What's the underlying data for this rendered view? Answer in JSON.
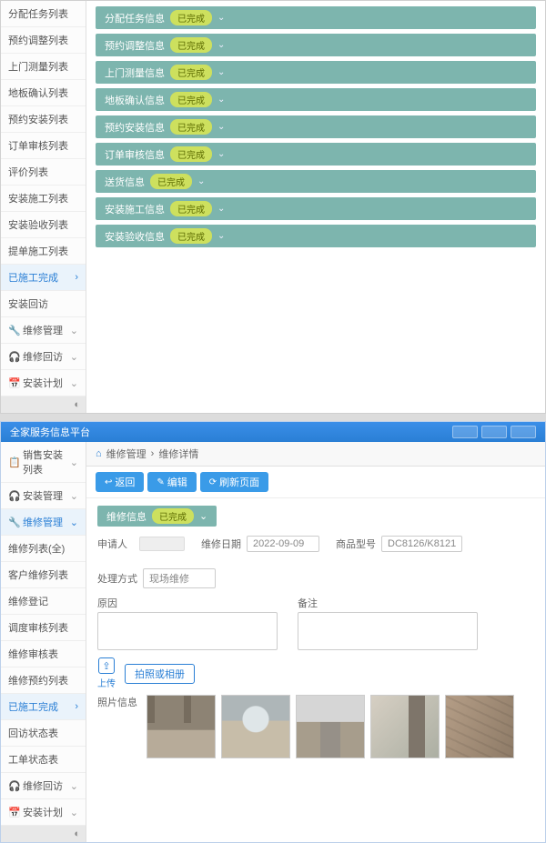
{
  "top": {
    "sidebar": {
      "items": [
        {
          "label": "分配任务列表"
        },
        {
          "label": "预约调整列表"
        },
        {
          "label": "上门测量列表"
        },
        {
          "label": "地板确认列表"
        },
        {
          "label": "预约安装列表"
        },
        {
          "label": "订单审核列表"
        },
        {
          "label": "评价列表"
        },
        {
          "label": "安装施工列表"
        },
        {
          "label": "安装验收列表"
        },
        {
          "label": "提单施工列表"
        },
        {
          "label": "已施工完成",
          "selected": true
        },
        {
          "label": "安装回访"
        }
      ],
      "bottom": [
        {
          "icon": "🔧",
          "label": "维修管理"
        },
        {
          "icon": "🎧",
          "label": "维修回访"
        },
        {
          "icon": "📅",
          "label": "安装计划"
        }
      ]
    },
    "accordions": [
      {
        "title": "分配任务信息",
        "badge": "已完成"
      },
      {
        "title": "预约调整信息",
        "badge": "已完成"
      },
      {
        "title": "上门测量信息",
        "badge": "已完成"
      },
      {
        "title": "地板确认信息",
        "badge": "已完成"
      },
      {
        "title": "预约安装信息",
        "badge": "已完成"
      },
      {
        "title": "订单审核信息",
        "badge": "已完成"
      },
      {
        "title": "送货信息",
        "badge": "已完成"
      },
      {
        "title": "安装施工信息",
        "badge": "已完成"
      },
      {
        "title": "安装验收信息",
        "badge": "已完成"
      }
    ]
  },
  "bottom": {
    "header": {
      "title": "全家服务信息平台"
    },
    "sidebar": {
      "pre": [
        {
          "icon": "📋",
          "label": "销售安装列表"
        },
        {
          "icon": "🎧",
          "label": "安装管理"
        }
      ],
      "groupLabel": "维修管理",
      "items": [
        {
          "label": "维修列表(全)"
        },
        {
          "label": "客户维修列表"
        },
        {
          "label": "维修登记"
        },
        {
          "label": "调度审核列表"
        },
        {
          "label": "维修审核表"
        },
        {
          "label": "维修预约列表"
        },
        {
          "label": "已施工完成",
          "selected": true
        },
        {
          "label": "回访状态表"
        },
        {
          "label": "工单状态表"
        }
      ],
      "post": [
        {
          "icon": "🎧",
          "label": "维修回访"
        },
        {
          "icon": "📅",
          "label": "安装计划"
        }
      ]
    },
    "crumb": {
      "home": "⌂",
      "a": "维修管理",
      "b": "维修详情"
    },
    "toolbar": {
      "back": "返回",
      "edit": "编辑",
      "refresh": "刷新页面"
    },
    "section": {
      "title": "维修信息",
      "badge": "已完成"
    },
    "form": {
      "applicant": {
        "label": "申请人",
        "value": ""
      },
      "date": {
        "label": "维修日期",
        "value": "2022-09-09"
      },
      "product": {
        "label": "商品型号",
        "value": "DC8126/K8121"
      },
      "method": {
        "label": "处理方式",
        "value": "现场维修"
      },
      "reason": {
        "label": "原因"
      },
      "note": {
        "label": "备注"
      }
    },
    "upload": {
      "caption": "上传",
      "btn": "拍照或相册"
    },
    "gallery": {
      "label": "照片信息"
    }
  }
}
